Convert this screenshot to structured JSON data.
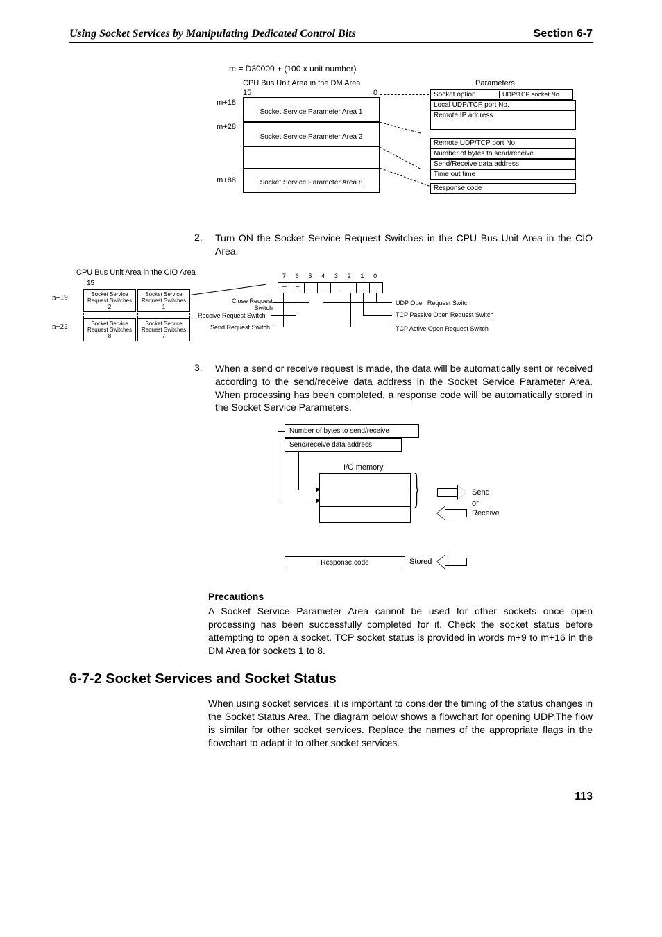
{
  "header": {
    "left": "Using Socket Services by Manipulating Dedicated Control Bits",
    "right": "Section 6-7"
  },
  "diagram1": {
    "formula": "m = D30000 + (100 x unit number)",
    "leftTitle": "CPU Bus Unit Area in the DM Area",
    "rightTitle": "Parameters",
    "axis15": "15",
    "axis0": "0",
    "keys": {
      "k1": "m+18",
      "k2": "m+28",
      "k3": "m+88"
    },
    "leftBoxes": {
      "b1": "Socket Service Parameter Area 1",
      "b2": "Socket Service Parameter Area 2",
      "b8": "Socket Service Parameter Area 8"
    },
    "rightBoxes": {
      "r1a": "Socket option",
      "r1b": "UDP/TCP socket No.",
      "r2": "Local UDP/TCP port No.",
      "r3": "Remote IP address",
      "r4": "Remote UDP/TCP port No.",
      "r5": "Number of bytes to send/receive",
      "r6": "Send/Receive data address",
      "r7": "Time out time",
      "r8": "Response code"
    }
  },
  "step2": {
    "num": "2.",
    "text": "Turn ON the Socket Service Request Switches in the CPU Bus Unit Area in the CIO Area."
  },
  "diagram2": {
    "title": "CPU Bus Unit Area in the CIO Area",
    "idx15": "15",
    "leftidx1": "n+19",
    "leftidx2": "n+22",
    "sw1": "Socket Service Request Switches 2",
    "sw2": "Socket Service Request Switches 1",
    "sw3": "Socket Service Request Switches 8",
    "sw4": "Socket Service Request Switches 7",
    "bits": {
      "b7": "7",
      "b6": "6",
      "b5": "5",
      "b4": "4",
      "b3": "3",
      "b2": "2",
      "b1": "1",
      "b0": "0"
    },
    "dash1": "–",
    "dash2": "–",
    "lblClose": "Close Request Switch",
    "lblRecv": "Receive Request Switch",
    "lblSend": "Send Request Switch",
    "lblUdp": "UDP Open Request Switch",
    "lblTcpP": "TCP Passive Open Request Switch",
    "lblTcpA": "TCP Active Open Request Switch"
  },
  "step3": {
    "num": "3.",
    "text": "When a send or receive request is made, the data will be automatically sent or received according to the send/receive data address in the Socket Service Parameter Area. When processing has been completed, a response code will be automatically stored in the Socket Service Parameters."
  },
  "diagram3": {
    "b1": "Number of bytes to send/receive",
    "b2": "Send/receive data address",
    "memTitle": "I/O memory",
    "send": "Send",
    "or": "or",
    "receive": "Receive",
    "resp": "Response code",
    "stored": "Stored"
  },
  "precautions": {
    "title": "Precautions",
    "text": "A Socket Service Parameter Area cannot be used for other sockets once open processing has been successfully completed for it. Check the socket status before attempting to open a socket. TCP socket status is provided in words m+9 to m+16 in the DM Area for sockets 1 to 8."
  },
  "section": {
    "heading": "6-7-2    Socket Services and Socket Status",
    "body": "When using socket services, it is important to consider the timing of the status changes in the Socket Status Area. The diagram below shows a flowchart for opening UDP.The flow is similar for other socket services. Replace the names of the appropriate flags in the flowchart to adapt it to other socket services."
  },
  "pageNum": "113"
}
